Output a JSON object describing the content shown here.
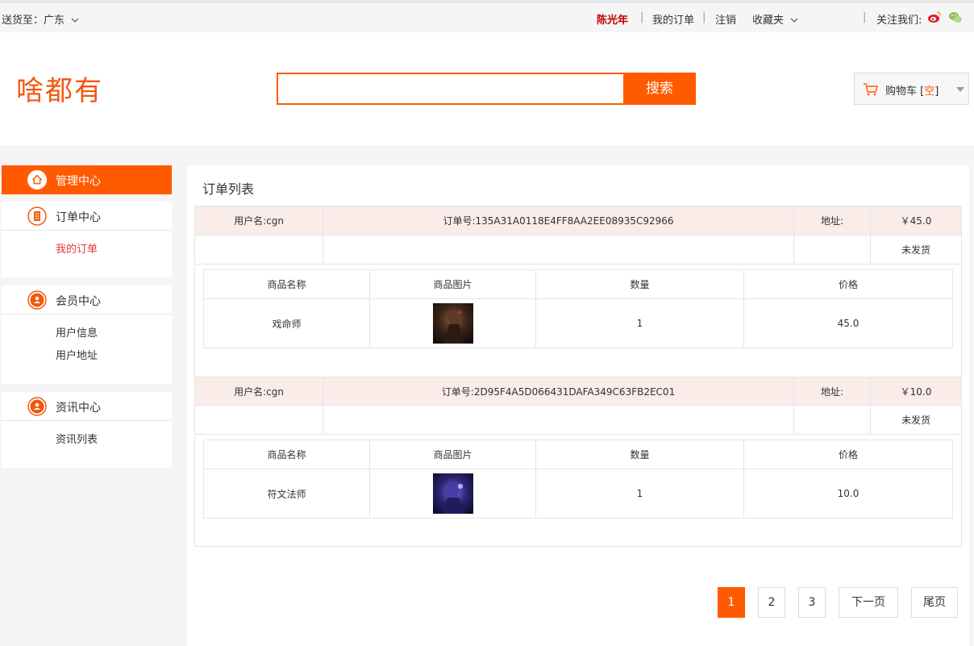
{
  "topbar": {
    "ship_to": "送货至：广东",
    "user": "陈光年",
    "my_orders": "我的订单",
    "logout": "注销",
    "favorites": "收藏夹",
    "follow": "关注我们:",
    "icons": [
      "weibo-icon",
      "wechat-icon"
    ]
  },
  "header": {
    "logo": "啥都有",
    "search_placeholder": "",
    "search_button": "搜索",
    "cart_label": "购物车 [",
    "cart_state": "空",
    "cart_close": "]"
  },
  "sidebar": {
    "admin": "管理中心",
    "orders_center": "订单中心",
    "my_orders": "我的订单",
    "member_center": "会员中心",
    "user_info": "用户信息",
    "user_address": "用户地址",
    "news_center": "资讯中心",
    "news_list": "资讯列表"
  },
  "main": {
    "title": "订单列表",
    "item_headers": [
      "商品名称",
      "商品图片",
      "数量",
      "价格"
    ],
    "orders": [
      {
        "user": "用户名:cgn",
        "order_no": "订单号:135A31A0118E4FF8AA2EE08935C92966",
        "address": "地址:",
        "total": "￥45.0",
        "status": "未发货",
        "items": [
          {
            "name": "戏命师",
            "qty": "1",
            "price": "45.0"
          }
        ]
      },
      {
        "user": "用户名:cgn",
        "order_no": "订单号:2D95F4A5D066431DAFA349C63FB2EC01",
        "address": "地址:",
        "total": "￥10.0",
        "status": "未发货",
        "items": [
          {
            "name": "符文法师",
            "qty": "1",
            "price": "10.0"
          }
        ]
      }
    ]
  },
  "pagination": {
    "pages": [
      "1",
      "2",
      "3"
    ],
    "current": "1",
    "next": "下一页",
    "last": "尾页"
  },
  "colors": {
    "accent": "#ff5a00",
    "logo": "#f2570f",
    "order_header_bg": "#f9ece9",
    "user_name": "#c40000"
  }
}
